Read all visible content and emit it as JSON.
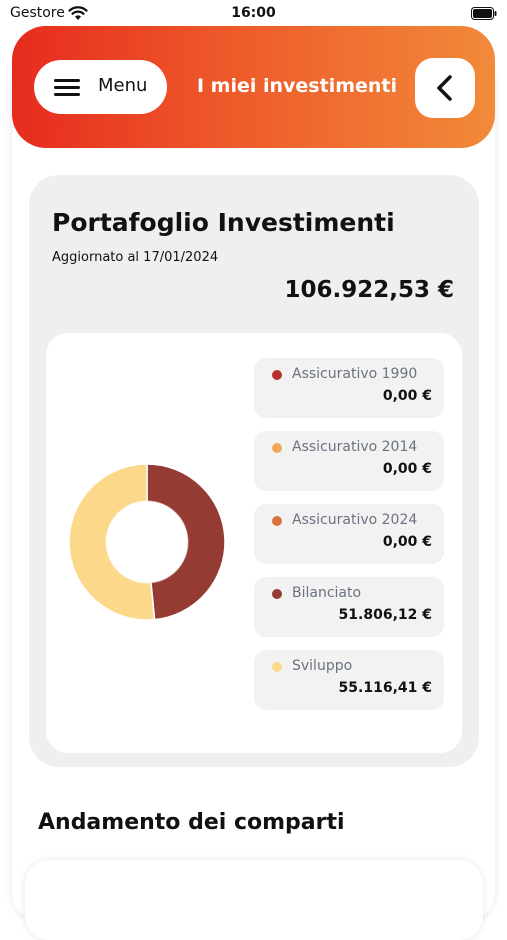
{
  "status_bar": {
    "carrier": "Gestore",
    "time": "16:00"
  },
  "header": {
    "menu_label": "Menu",
    "title": "I miei investimenti"
  },
  "portfolio": {
    "title": "Portafoglio Investimenti",
    "updated": "Aggiornato al 17/01/2024",
    "total": "106.922,53 €"
  },
  "legend": [
    {
      "name": "Assicurativo 1990",
      "value": "0,00 €",
      "color": "#b8322b"
    },
    {
      "name": "Assicurativo 2014",
      "value": "0,00 €",
      "color": "#f0a857"
    },
    {
      "name": "Assicurativo 2024",
      "value": "0,00 €",
      "color": "#d9733d"
    },
    {
      "name": "Bilanciato",
      "value": "51.806,12 €",
      "color": "#943b34"
    },
    {
      "name": "Sviluppo",
      "value": "55.116,41 €",
      "color": "#fcd98a"
    }
  ],
  "chart_data": {
    "type": "pie",
    "categories": [
      "Assicurativo 1990",
      "Assicurativo 2014",
      "Assicurativo 2024",
      "Bilanciato",
      "Sviluppo"
    ],
    "values": [
      0,
      0,
      0,
      51806.12,
      55116.41
    ],
    "colors": [
      "#b8322b",
      "#f0a857",
      "#d9733d",
      "#943b34",
      "#fcd98a"
    ],
    "donut": true
  },
  "section": {
    "title": "Andamento dei comparti"
  }
}
